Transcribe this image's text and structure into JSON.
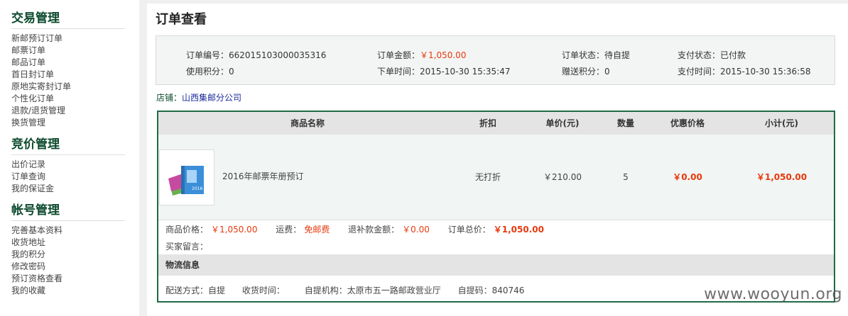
{
  "sidebar": {
    "groups": [
      {
        "title": "交易管理",
        "items": [
          "新邮预订订单",
          "邮票订单",
          "邮品订单",
          "首日封订单",
          "原地实寄封订单",
          "个性化订单",
          "退款/退货管理",
          "换货管理"
        ]
      },
      {
        "title": "竞价管理",
        "items": [
          "出价记录",
          "订单查询",
          "我的保证金"
        ]
      },
      {
        "title": "帐号管理",
        "items": [
          "完善基本资料",
          "收货地址",
          "我的积分",
          "修改密码",
          "预订资格查看",
          "我的收藏"
        ]
      }
    ]
  },
  "page": {
    "title": "订单查看"
  },
  "order_info": {
    "order_no_label": "订单编号：",
    "order_no": "662015103000035316",
    "amount_label": "订单金额：",
    "amount": "￥1,050.00",
    "status_label": "订单状态：",
    "status": "待自提",
    "pay_status_label": "支付状态：",
    "pay_status": "已付款",
    "points_used_label": "使用积分：",
    "points_used": "0",
    "order_time_label": "下单时间：",
    "order_time": "2015-10-30 15:35:47",
    "points_gift_label": "赠送积分：",
    "points_gift": "0",
    "pay_time_label": "支付时间：",
    "pay_time": "2015-10-30 15:36:58"
  },
  "store": {
    "label": "店铺：",
    "name": "山西集邮分公司"
  },
  "table": {
    "headers": [
      "商品名称",
      "折扣",
      "单价(元)",
      "数量",
      "优惠价格",
      "小计(元)"
    ],
    "rows": [
      {
        "name": "2016年邮票年册预订",
        "discount": "无打折",
        "price": "￥210.00",
        "qty": "5",
        "promo_price": "￥0.00",
        "subtotal": "￥1,050.00",
        "thumb_text": "2016"
      }
    ]
  },
  "summary": {
    "goods_label": "商品价格：",
    "goods_value": "￥1,050.00",
    "shipping_label": "运费：",
    "shipping_value": "免邮费",
    "refund_label": "退补款金额：",
    "refund_value": "￥0.00",
    "total_label": "订单总价：",
    "total_value": "￥1,050.00",
    "note_label": "买家留言："
  },
  "logistics": {
    "title": "物流信息",
    "method_label": "配送方式：",
    "method": "自提",
    "time_label": "收货时间：",
    "time": "",
    "org_label": "自提机构：",
    "org": "太原市五一路邮政营业厅",
    "code_label": "自提码：",
    "code": "840746"
  },
  "watermark": "www.wooyun.org",
  "colors": {
    "accent": "#0c4a2c",
    "price": "#e8380d",
    "border": "#1f6b46"
  }
}
